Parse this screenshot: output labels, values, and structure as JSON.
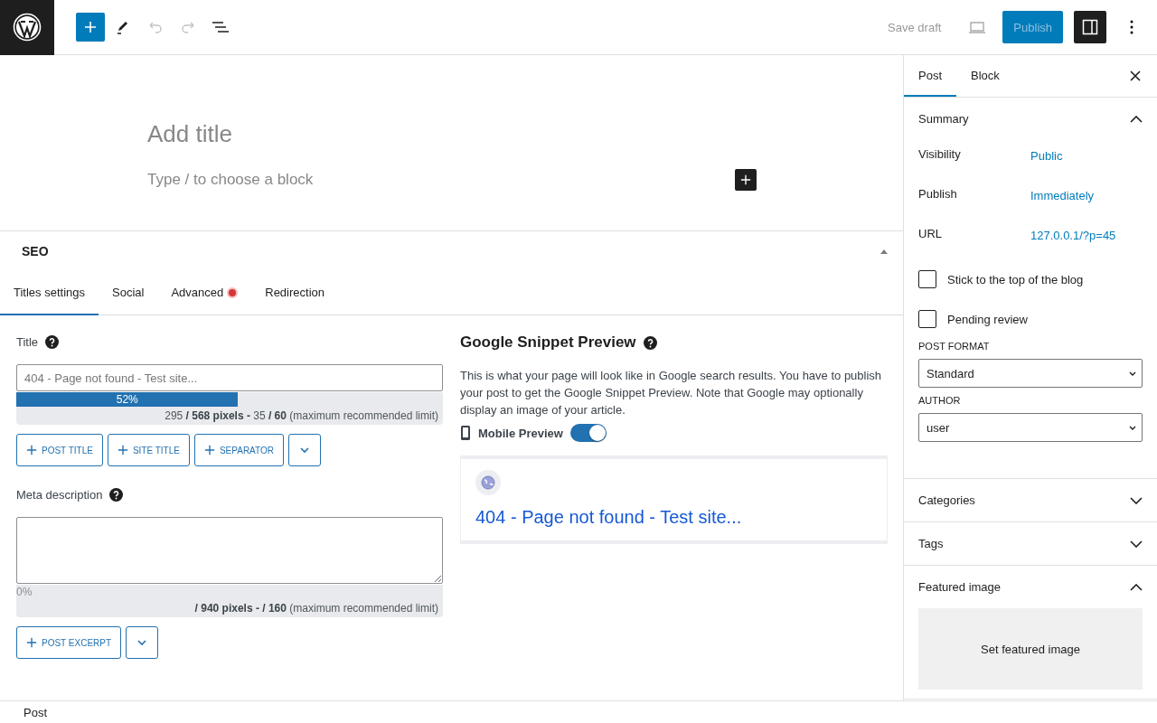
{
  "toolbar": {
    "save_draft": "Save draft",
    "publish": "Publish",
    "undo_disabled": true,
    "redo_disabled": true,
    "sidebar_open": true
  },
  "editor": {
    "title_placeholder": "Add title",
    "block_placeholder": "Type / to choose a block"
  },
  "seo": {
    "heading": "SEO",
    "expanded": true,
    "tabs": [
      {
        "label": "Titles settings",
        "selected": true,
        "alert": false
      },
      {
        "label": "Social",
        "selected": false,
        "alert": false
      },
      {
        "label": "Advanced",
        "selected": false,
        "alert": true
      },
      {
        "label": "Redirection",
        "selected": false,
        "alert": false
      }
    ],
    "title": {
      "label": "Title",
      "placeholder": "404 - Page not found - Test site...",
      "level": 0.52,
      "percent": "52%",
      "counter": "295 **/ 568 pixels -** 35  **/ 60** (maximum recommended limit)",
      "buttons": [
        "POST TITLE",
        "SITE TITLE",
        "SEPARATOR"
      ]
    },
    "meta": {
      "label": "Meta description",
      "level": 0,
      "percent": "0%",
      "counter": "**/ 940 pixels -**  **/ 160** (maximum recommended limit)",
      "buttons": [
        "POST EXCERPT"
      ]
    },
    "preview": {
      "heading": "Google Snippet Preview",
      "description": "This is what your page will look like in Google search results. You have to publish your post to get the Google Snippet Preview. Note that Google may optionally display an image of your article.",
      "mobile_label": "Mobile Preview",
      "mobile_on": true,
      "result_title": "404 - Page not found - Test site..."
    }
  },
  "sidebar": {
    "tabs": [
      {
        "label": "Post",
        "selected": true
      },
      {
        "label": "Block",
        "selected": false
      }
    ],
    "summary": {
      "heading": "Summary",
      "expanded": true,
      "rows": [
        {
          "label": "Visibility",
          "value": "Public"
        },
        {
          "label": "Publish",
          "value": "Immediately"
        },
        {
          "label": "URL",
          "value": "127.0.0.1/?p=45"
        }
      ],
      "checkboxes": [
        {
          "label": "Stick to the top of the blog",
          "checked": false
        },
        {
          "label": "Pending review",
          "checked": false
        }
      ],
      "selects": [
        {
          "label": "POST FORMAT",
          "value": "Standard"
        },
        {
          "label": "AUTHOR",
          "value": "user"
        }
      ]
    },
    "panels": [
      {
        "heading": "Categories",
        "expanded": false
      },
      {
        "heading": "Tags",
        "expanded": false
      },
      {
        "heading": "Featured image",
        "expanded": true,
        "action": "Set featured image"
      }
    ]
  },
  "footer": {
    "breadcrumb": "Post"
  }
}
